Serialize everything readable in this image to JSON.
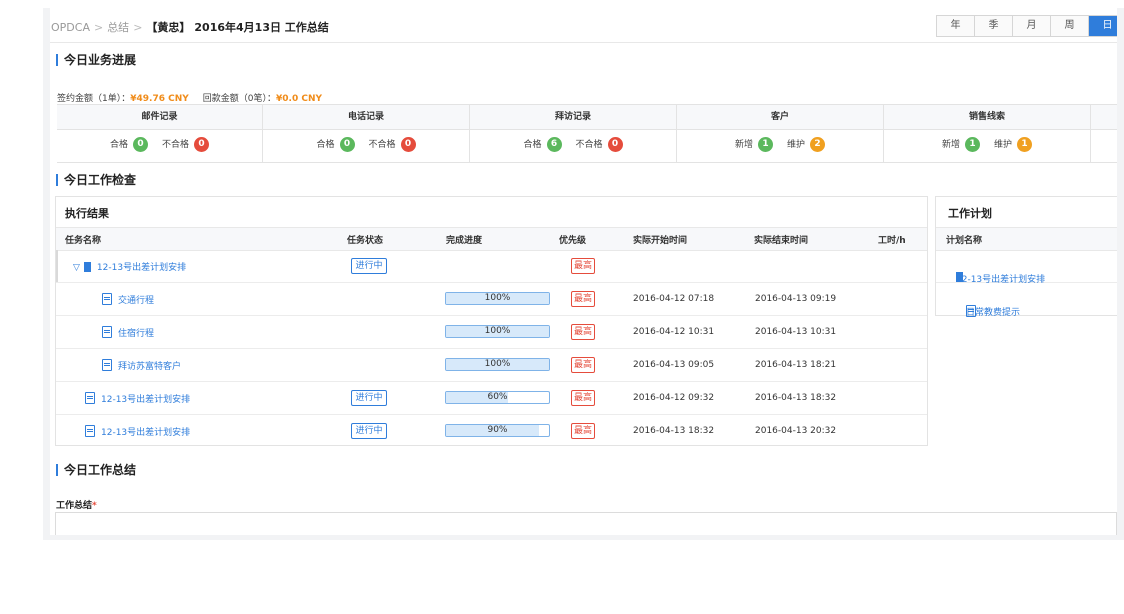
{
  "breadcrumb": {
    "root": "OPDCA",
    "summary": "总结",
    "person": "【黄忠】",
    "title": "2016年4月13日 工作总结"
  },
  "period_tabs": [
    "年",
    "季",
    "月",
    "周",
    "日"
  ],
  "period_active": "日",
  "progress_section": {
    "title": "今日业务进展",
    "signed_label": "签约金额（1单）：",
    "signed_value": "¥49.76 CNY",
    "refund_label": "回款金额（0笔）：",
    "refund_value": "¥0.0 CNY",
    "columns": [
      {
        "header": "邮件记录",
        "items": [
          {
            "label": "合格",
            "count": "0",
            "color": "#5bb85d"
          },
          {
            "label": "不合格",
            "count": "0",
            "color": "#e54c3c"
          }
        ]
      },
      {
        "header": "电话记录",
        "items": [
          {
            "label": "合格",
            "count": "0",
            "color": "#5bb85d"
          },
          {
            "label": "不合格",
            "count": "0",
            "color": "#e54c3c"
          }
        ]
      },
      {
        "header": "拜访记录",
        "items": [
          {
            "label": "合格",
            "count": "6",
            "color": "#5bb85d"
          },
          {
            "label": "不合格",
            "count": "0",
            "color": "#e54c3c"
          }
        ]
      },
      {
        "header": "客户",
        "items": [
          {
            "label": "新增",
            "count": "1",
            "color": "#5bb85d"
          },
          {
            "label": "维护",
            "count": "2",
            "color": "#f0a020"
          }
        ]
      },
      {
        "header": "销售线索",
        "items": [
          {
            "label": "新增",
            "count": "1",
            "color": "#5bb85d"
          },
          {
            "label": "维护",
            "count": "1",
            "color": "#f0a020"
          }
        ]
      }
    ]
  },
  "check_section": {
    "title": "今日工作检查"
  },
  "execution": {
    "title": "执行结果",
    "headers": {
      "name": "任务名称",
      "status": "任务状态",
      "progress": "完成进度",
      "priority": "优先级",
      "start": "实际开始时间",
      "end": "实际结束时间",
      "hours": "工时/h"
    },
    "rows": [
      {
        "name": "12-13号出差计划安排",
        "status": "进行中",
        "progress_text": "",
        "progress": null,
        "priority": "最高",
        "start": "",
        "end": "",
        "kind": "parent"
      },
      {
        "name": "交通行程",
        "status": "",
        "progress_text": "100%",
        "progress": 1.0,
        "priority": "最高",
        "start": "2016-04-12 07:18",
        "end": "2016-04-13 09:19",
        "kind": "child"
      },
      {
        "name": "住宿行程",
        "status": "",
        "progress_text": "100%",
        "progress": 1.0,
        "priority": "最高",
        "start": "2016-04-12 10:31",
        "end": "2016-04-13 10:31",
        "kind": "child"
      },
      {
        "name": "拜访苏富特客户",
        "status": "",
        "progress_text": "100%",
        "progress": 1.0,
        "priority": "最高",
        "start": "2016-04-13 09:05",
        "end": "2016-04-13 18:21",
        "kind": "child"
      },
      {
        "name": "12-13号出差计划安排",
        "status": "进行中",
        "progress_text": "60%",
        "progress": 0.6,
        "priority": "最高",
        "start": "2016-04-12 09:32",
        "end": "2016-04-13 18:32",
        "kind": "task"
      },
      {
        "name": "12-13号出差计划安排",
        "status": "进行中",
        "progress_text": "90%",
        "progress": 0.9,
        "priority": "最高",
        "start": "2016-04-13 18:32",
        "end": "2016-04-13 20:32",
        "kind": "task"
      }
    ]
  },
  "plan": {
    "title": "工作计划",
    "header": "计划名称",
    "rows": [
      {
        "name": "12-13号出差计划安排",
        "kind": "folder"
      },
      {
        "name": "日常教费提示",
        "kind": "doc"
      }
    ]
  },
  "summary_section": {
    "title": "今日工作总结",
    "field_label": "工作总结",
    "required_mark": "*"
  }
}
